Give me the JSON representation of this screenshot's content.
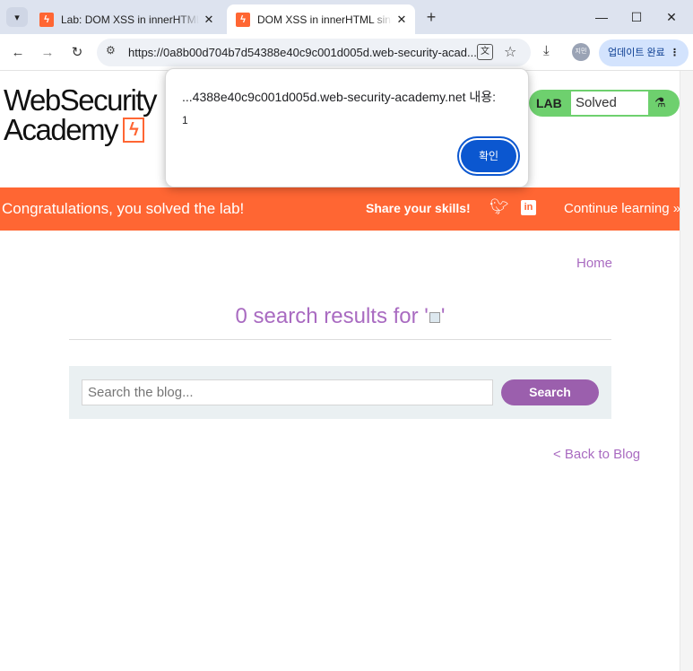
{
  "browser": {
    "tab_list_icon": "chevron-down-icon",
    "tabs": [
      {
        "title": "Lab: DOM XSS in innerHTML sink",
        "favicon": "portswigger-icon",
        "close": "✕"
      },
      {
        "title": "DOM XSS in innerHTML sink using",
        "favicon": "portswigger-icon",
        "close": "✕"
      }
    ],
    "new_tab": "+",
    "window_controls": {
      "minimize": "—",
      "maximize": "☐",
      "close": "✕"
    },
    "nav": {
      "back": "←",
      "forward": "→",
      "reload": "↻"
    },
    "url": "https://0a8b00d704b7d54388e40c9c001d005d.web-security-acad...",
    "translate_icon": "translate-icon",
    "bookmark_icon": "star-icon",
    "download_icon": "download-icon",
    "profile_label": "지민",
    "update_button": "업데이트 완료",
    "menu_dots": "⋮"
  },
  "page": {
    "logo": {
      "line1": "WebSecurity",
      "line2": "Academy"
    },
    "lab_status": {
      "badge": "LAB",
      "state": "Solved",
      "icon": "flask-icon"
    },
    "banner": {
      "congrats": "Congratulations, you solved the lab!",
      "share": "Share your skills!",
      "continue": "Continue learning »",
      "accent": "#ff6633"
    },
    "home_link": "Home",
    "results_prefix": "0 search results for '",
    "results_suffix": "'",
    "search": {
      "placeholder": "Search the blog...",
      "button": "Search"
    },
    "back_link": "< Back to Blog",
    "link_color": "#a96bc1",
    "button_color": "#9b5fad"
  },
  "dialog": {
    "origin": "...4388e40c9c001d005d.web-security-academy.net 내용:",
    "message": "1",
    "ok": "확인"
  }
}
